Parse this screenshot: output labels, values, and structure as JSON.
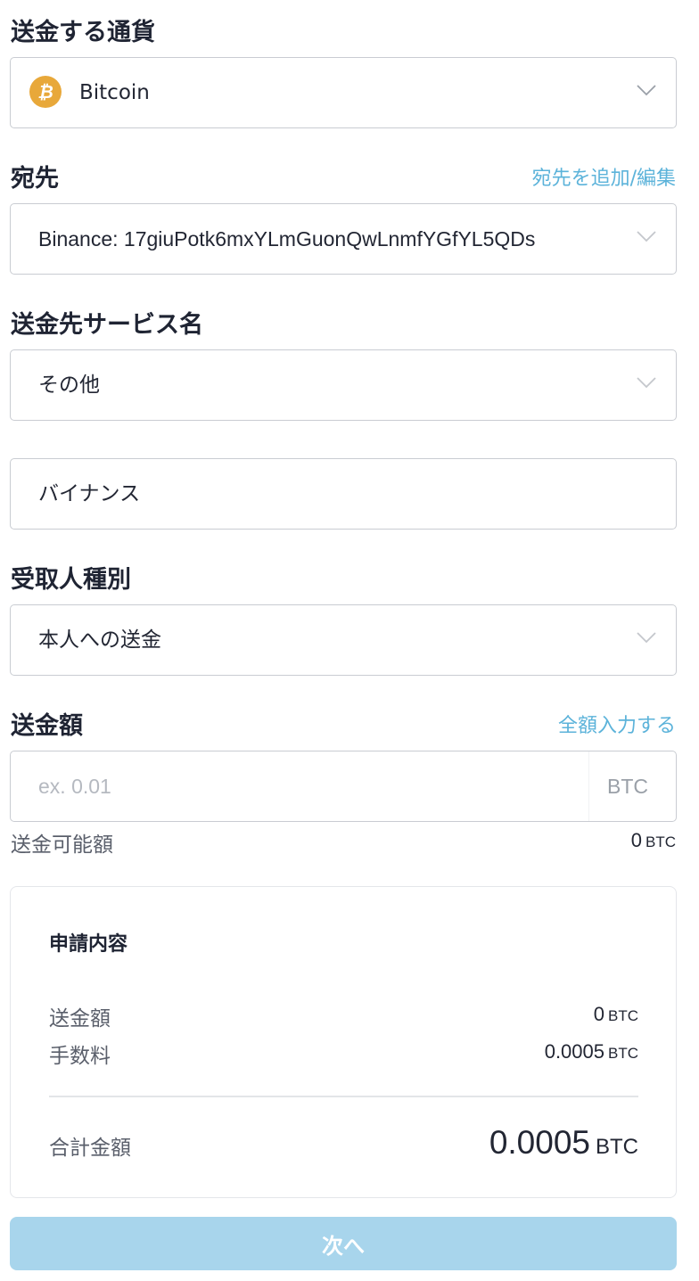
{
  "currency": {
    "label": "送金する通貨",
    "selected": "Bitcoin",
    "icon": "bitcoin-icon",
    "icon_color": "#e8a83a"
  },
  "destination": {
    "label": "宛先",
    "edit_link": "宛先を追加/編集",
    "selected": "Binance: 17giuPotk6mxYLmGuonQwLnmfYGfYL5QDs"
  },
  "service": {
    "label": "送金先サービス名",
    "selected": "その他",
    "custom_name": "バイナンス"
  },
  "recipient_type": {
    "label": "受取人種別",
    "selected": "本人への送金"
  },
  "amount": {
    "label": "送金額",
    "fill_all_link": "全額入力する",
    "placeholder": "ex. 0.01",
    "unit": "BTC",
    "available_label": "送金可能額",
    "available_value": "0",
    "available_unit": "BTC"
  },
  "summary": {
    "title": "申請内容",
    "amount_label": "送金額",
    "amount_value": "0",
    "amount_unit": "BTC",
    "fee_label": "手数料",
    "fee_value": "0.0005",
    "fee_unit": "BTC",
    "total_label": "合計金額",
    "total_value": "0.0005",
    "total_unit": "BTC"
  },
  "next_button": "次へ",
  "colors": {
    "accent_link": "#5cb3da",
    "button_disabled": "#a8d5ec"
  }
}
